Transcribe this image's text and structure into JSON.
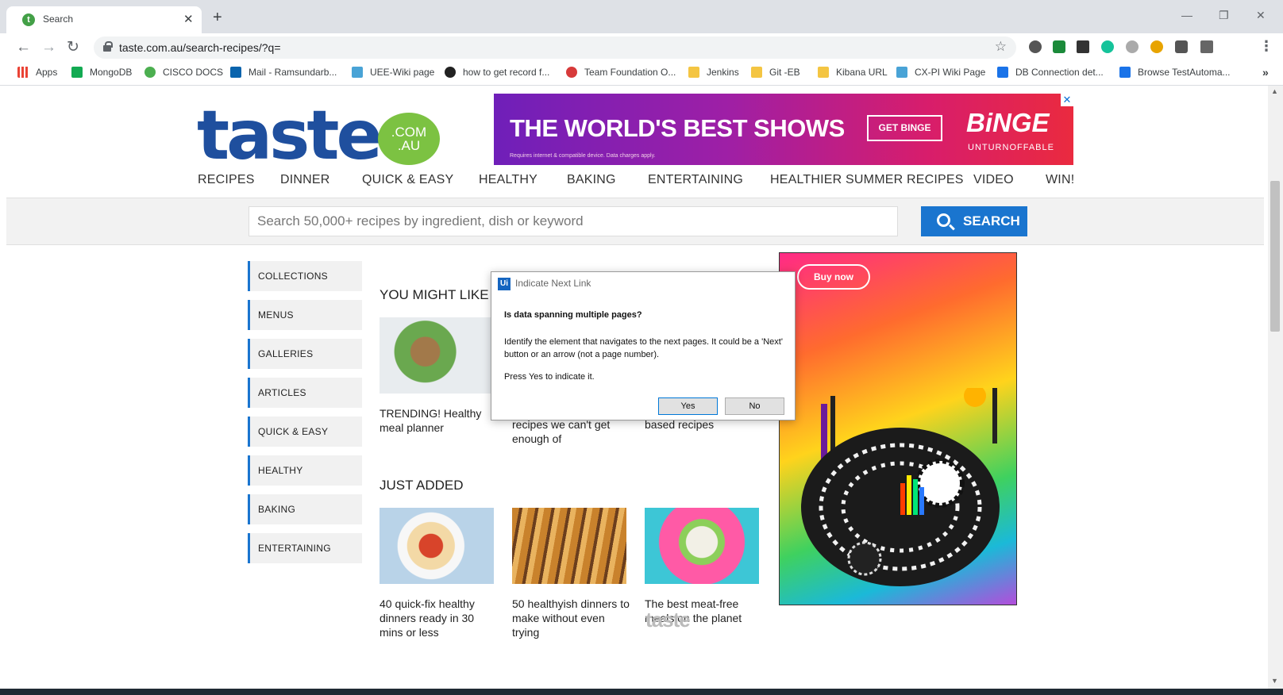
{
  "browser": {
    "tab_title": "Search",
    "tab_close": "✕",
    "new_tab": "+",
    "url": "taste.com.au/search-recipes/?q=",
    "bookmarks": [
      "Apps",
      "MongoDB",
      "CISCO DOCS",
      "Mail - Ramsundarb...",
      "UEE-Wiki page",
      "how to get record f...",
      "Team Foundation O...",
      "Jenkins",
      "Git -EB",
      "Kibana URL",
      "CX-PI Wiki Page",
      "DB Connection det...",
      "Browse TestAutoma..."
    ],
    "bookmarks_more": "»",
    "controls": {
      "back": "←",
      "forward": "→",
      "reload": "↻",
      "star": "☆",
      "menu": "⋮",
      "minimize": "—",
      "restore": "❐",
      "close": "✕"
    }
  },
  "site": {
    "logo_text": "taste",
    "logo_badge": [
      ".COM",
      ".AU"
    ],
    "banner_ad": {
      "headline": "THE WORLD'S BEST SHOWS",
      "cta": "GET BINGE",
      "brand": "BiNGE",
      "tagline": "UNTURNOFFABLE",
      "fineprint": "Requires internet & compatible device. Data charges apply."
    },
    "nav": [
      "RECIPES",
      "DINNER",
      "QUICK & EASY",
      "HEALTHY",
      "BAKING",
      "ENTERTAINING",
      "HEALTHIER SUMMER RECIPES",
      "VIDEO",
      "WIN!"
    ],
    "search": {
      "placeholder": "Search 50,000+ recipes by ingredient, dish or keyword",
      "button": "SEARCH"
    },
    "sidebar": [
      "COLLECTIONS",
      "MENUS",
      "GALLERIES",
      "ARTICLES",
      "QUICK & EASY",
      "HEALTHY",
      "BAKING",
      "ENTERTAINING"
    ],
    "you_might_like": {
      "title": "YOU MIGHT LIKE",
      "cards": [
        "TRENDING! Healthy meal planner",
        "recipes we can't get enough of",
        "based recipes"
      ]
    },
    "just_added": {
      "title": "JUST ADDED",
      "cards": [
        "40 quick-fix healthy dinners ready in 30 mins or less",
        "50 healthyish dinners to make without even trying",
        "The best meat-free meals on the planet"
      ]
    },
    "side_ad": {
      "cta": "Buy now"
    },
    "watermark": "taste"
  },
  "dialog": {
    "app_icon": "Ui",
    "title": "Indicate Next Link",
    "question": "Is data spanning multiple pages?",
    "body": "Identify the element that navigates to the next pages. It could be a 'Next' button or an arrow (not a page number).",
    "hint": "Press Yes to indicate it.",
    "yes": "Yes",
    "no": "No"
  },
  "colors": {
    "brand_blue": "#1f4f9e",
    "brand_green": "#7cc242",
    "search_blue": "#1a75cf"
  }
}
